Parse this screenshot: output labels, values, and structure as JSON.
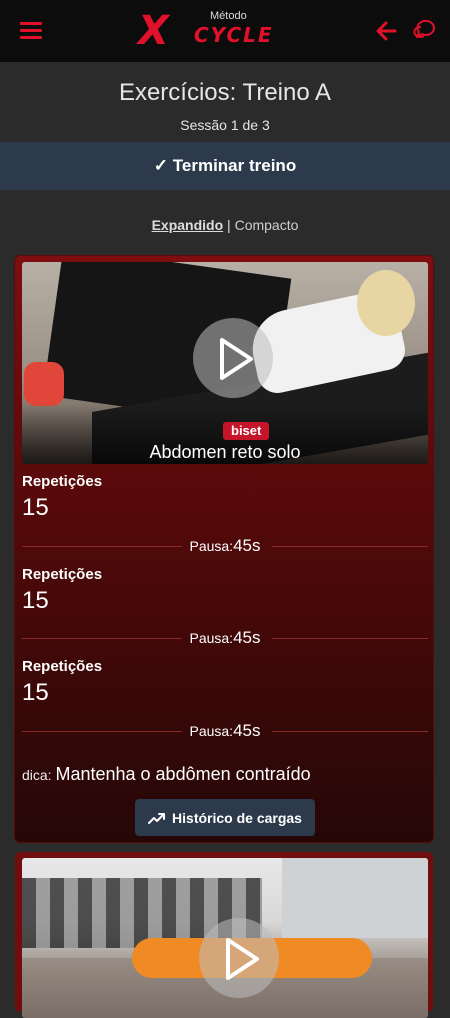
{
  "header": {
    "logo_small": "Método",
    "logo_x": "X",
    "logo_cycle": "CYCLE"
  },
  "page": {
    "title": "Exercícios: Treino A",
    "session": "Sessão 1 de 3",
    "finish_button": "✓ Terminar treino",
    "view_expanded": "Expandido",
    "view_separator": " | ",
    "view_compact": "Compacto"
  },
  "colors": {
    "accent": "#e1102b",
    "bar": "#2c3a4b",
    "card": "#7e0e10"
  },
  "exercise": {
    "badge": "biset",
    "name": "Abdomen reto solo",
    "sets": [
      {
        "reps_label": "Repetições",
        "reps_value": "15",
        "pause_label": "Pausa:",
        "pause_value": "45s"
      },
      {
        "reps_label": "Repetições",
        "reps_value": "15",
        "pause_label": "Pausa:",
        "pause_value": "45s"
      },
      {
        "reps_label": "Repetições",
        "reps_value": "15",
        "pause_label": "Pausa:",
        "pause_value": "45s"
      }
    ],
    "tip_label": "dica: ",
    "tip_text": "Mantenha o abdômen contraído",
    "history_button": "Histórico de cargas"
  },
  "icons": {
    "menu": "hamburger-icon",
    "back": "arrow-left-icon",
    "chat": "chat-bubble-icon",
    "play": "play-icon",
    "trend": "trending-up-icon"
  }
}
